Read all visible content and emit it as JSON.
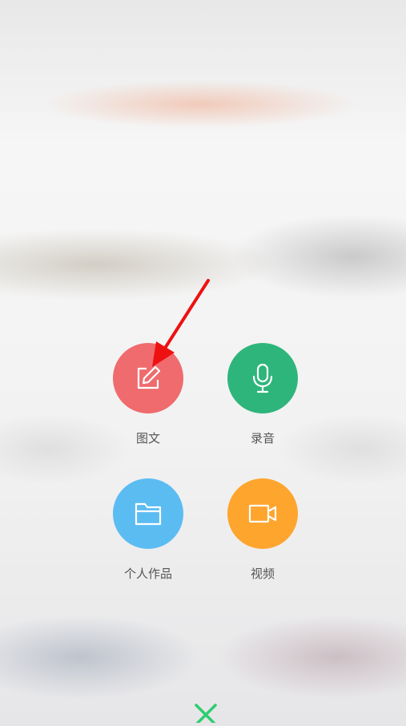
{
  "menu": {
    "items": [
      {
        "label": "图文",
        "icon": "edit-icon",
        "color": "#ef6b6e"
      },
      {
        "label": "录音",
        "icon": "microphone-icon",
        "color": "#2eb57b"
      },
      {
        "label": "个人作品",
        "icon": "folder-icon",
        "color": "#5bbcf2"
      },
      {
        "label": "视频",
        "icon": "video-camera-icon",
        "color": "#fea52e"
      }
    ]
  },
  "close": {
    "icon": "close-icon",
    "color": "#2ecc71"
  },
  "annotation": {
    "icon": "arrow-pointer-icon",
    "color": "#ee1111"
  }
}
